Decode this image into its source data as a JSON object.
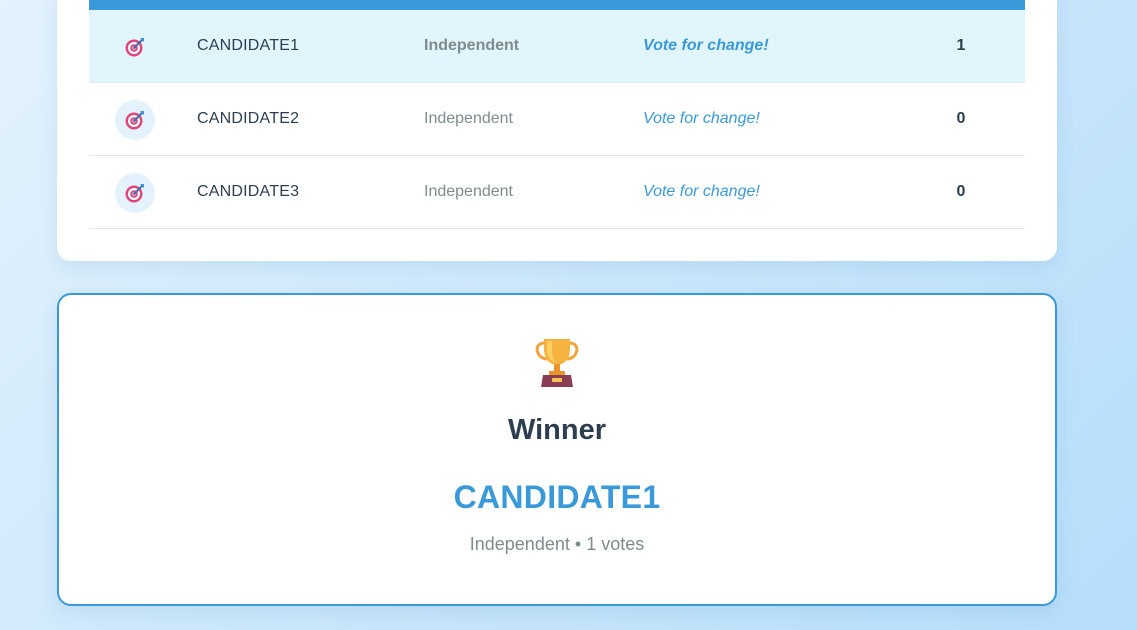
{
  "results": {
    "rows": [
      {
        "icon": "target-icon",
        "name": "CANDIDATE1",
        "party": "Independent",
        "slogan": "Vote for change!",
        "votes": "1",
        "leading": true
      },
      {
        "icon": "target-icon",
        "name": "CANDIDATE2",
        "party": "Independent",
        "slogan": "Vote for change!",
        "votes": "0",
        "leading": false
      },
      {
        "icon": "target-icon",
        "name": "CANDIDATE3",
        "party": "Independent",
        "slogan": "Vote for change!",
        "votes": "0",
        "leading": false
      }
    ]
  },
  "winner": {
    "icon": "trophy-icon",
    "heading": "Winner",
    "name": "CANDIDATE1",
    "party": "Independent",
    "separator": "•",
    "votes_text": "1 votes"
  },
  "colors": {
    "accent": "#3a9ad9",
    "text_dark": "#2c3e50",
    "text_muted": "#7f8c8d",
    "leading_row_bg": "#e1f5fd"
  }
}
